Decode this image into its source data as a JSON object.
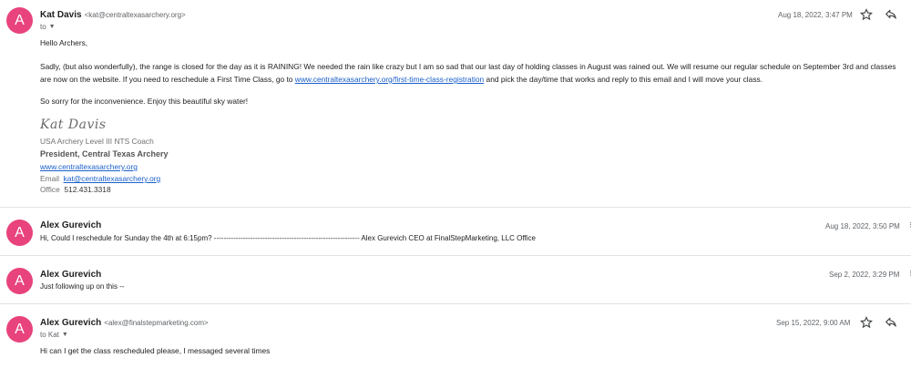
{
  "messages": [
    {
      "avatar": "A",
      "sender": "Kat Davis",
      "email": "<kat@centraltexasarchery.org>",
      "to": "to",
      "date": "Aug 18, 2022, 3:47 PM",
      "body": {
        "greeting": "Hello Archers,",
        "line1": "Sadly, (but also wonderfully), the range is closed for the day as it is RAINING! We needed the rain like crazy but I am so sad that our last day of holding classes in August was rained out. We will resume our regular schedule on September 3rd and classes",
        "line2_pre": "are now on the website. If you need to reschedule a First Time Class, go to ",
        "line2_link": "www.centraltexasarchery.org/first-time-class-registration",
        "line2_post": " and pick the day/time that works and reply to this email and I will move your class.",
        "closing": "So sorry for the inconvenience. Enjoy this beautiful sky water!"
      },
      "signature": {
        "script": "Kat Davis",
        "title": "USA Archery Level III NTS Coach",
        "role_prefix": "President, ",
        "role_org": "Central Texas Archery",
        "website": "www.centraltexasarchery.org",
        "email_label": "Email",
        "email": "kat@centraltexasarchery.org",
        "office_label": "Office",
        "office": "512.431.3318"
      }
    },
    {
      "avatar": "A",
      "sender": "Alex Gurevich",
      "date": "Aug 18, 2022, 3:50 PM",
      "snippet": "Hi, Could I reschedule for Sunday the 4th at 6:15pm? ------------------------------------------------------------ Alex Gurevich CEO at FinalStepMarketing, LLC Office"
    },
    {
      "avatar": "A",
      "sender": "Alex Gurevich",
      "date": "Sep 2, 2022, 3:29 PM",
      "snippet": "Just following up on this --"
    },
    {
      "avatar": "A",
      "sender": "Alex Gurevich",
      "email": "<alex@finalstepmarketing.com>",
      "to": "to Kat",
      "date": "Sep 15, 2022, 9:00 AM",
      "body": "Hi can I get the class rescheduled please, I messaged several times"
    }
  ],
  "icons": {
    "star": "star-icon",
    "reply": "reply-icon",
    "more": "more-vert-icon",
    "dropdown": "chevron-down-icon"
  },
  "colors": {
    "avatar": "#e8437c",
    "link": "#1a5fc9"
  }
}
